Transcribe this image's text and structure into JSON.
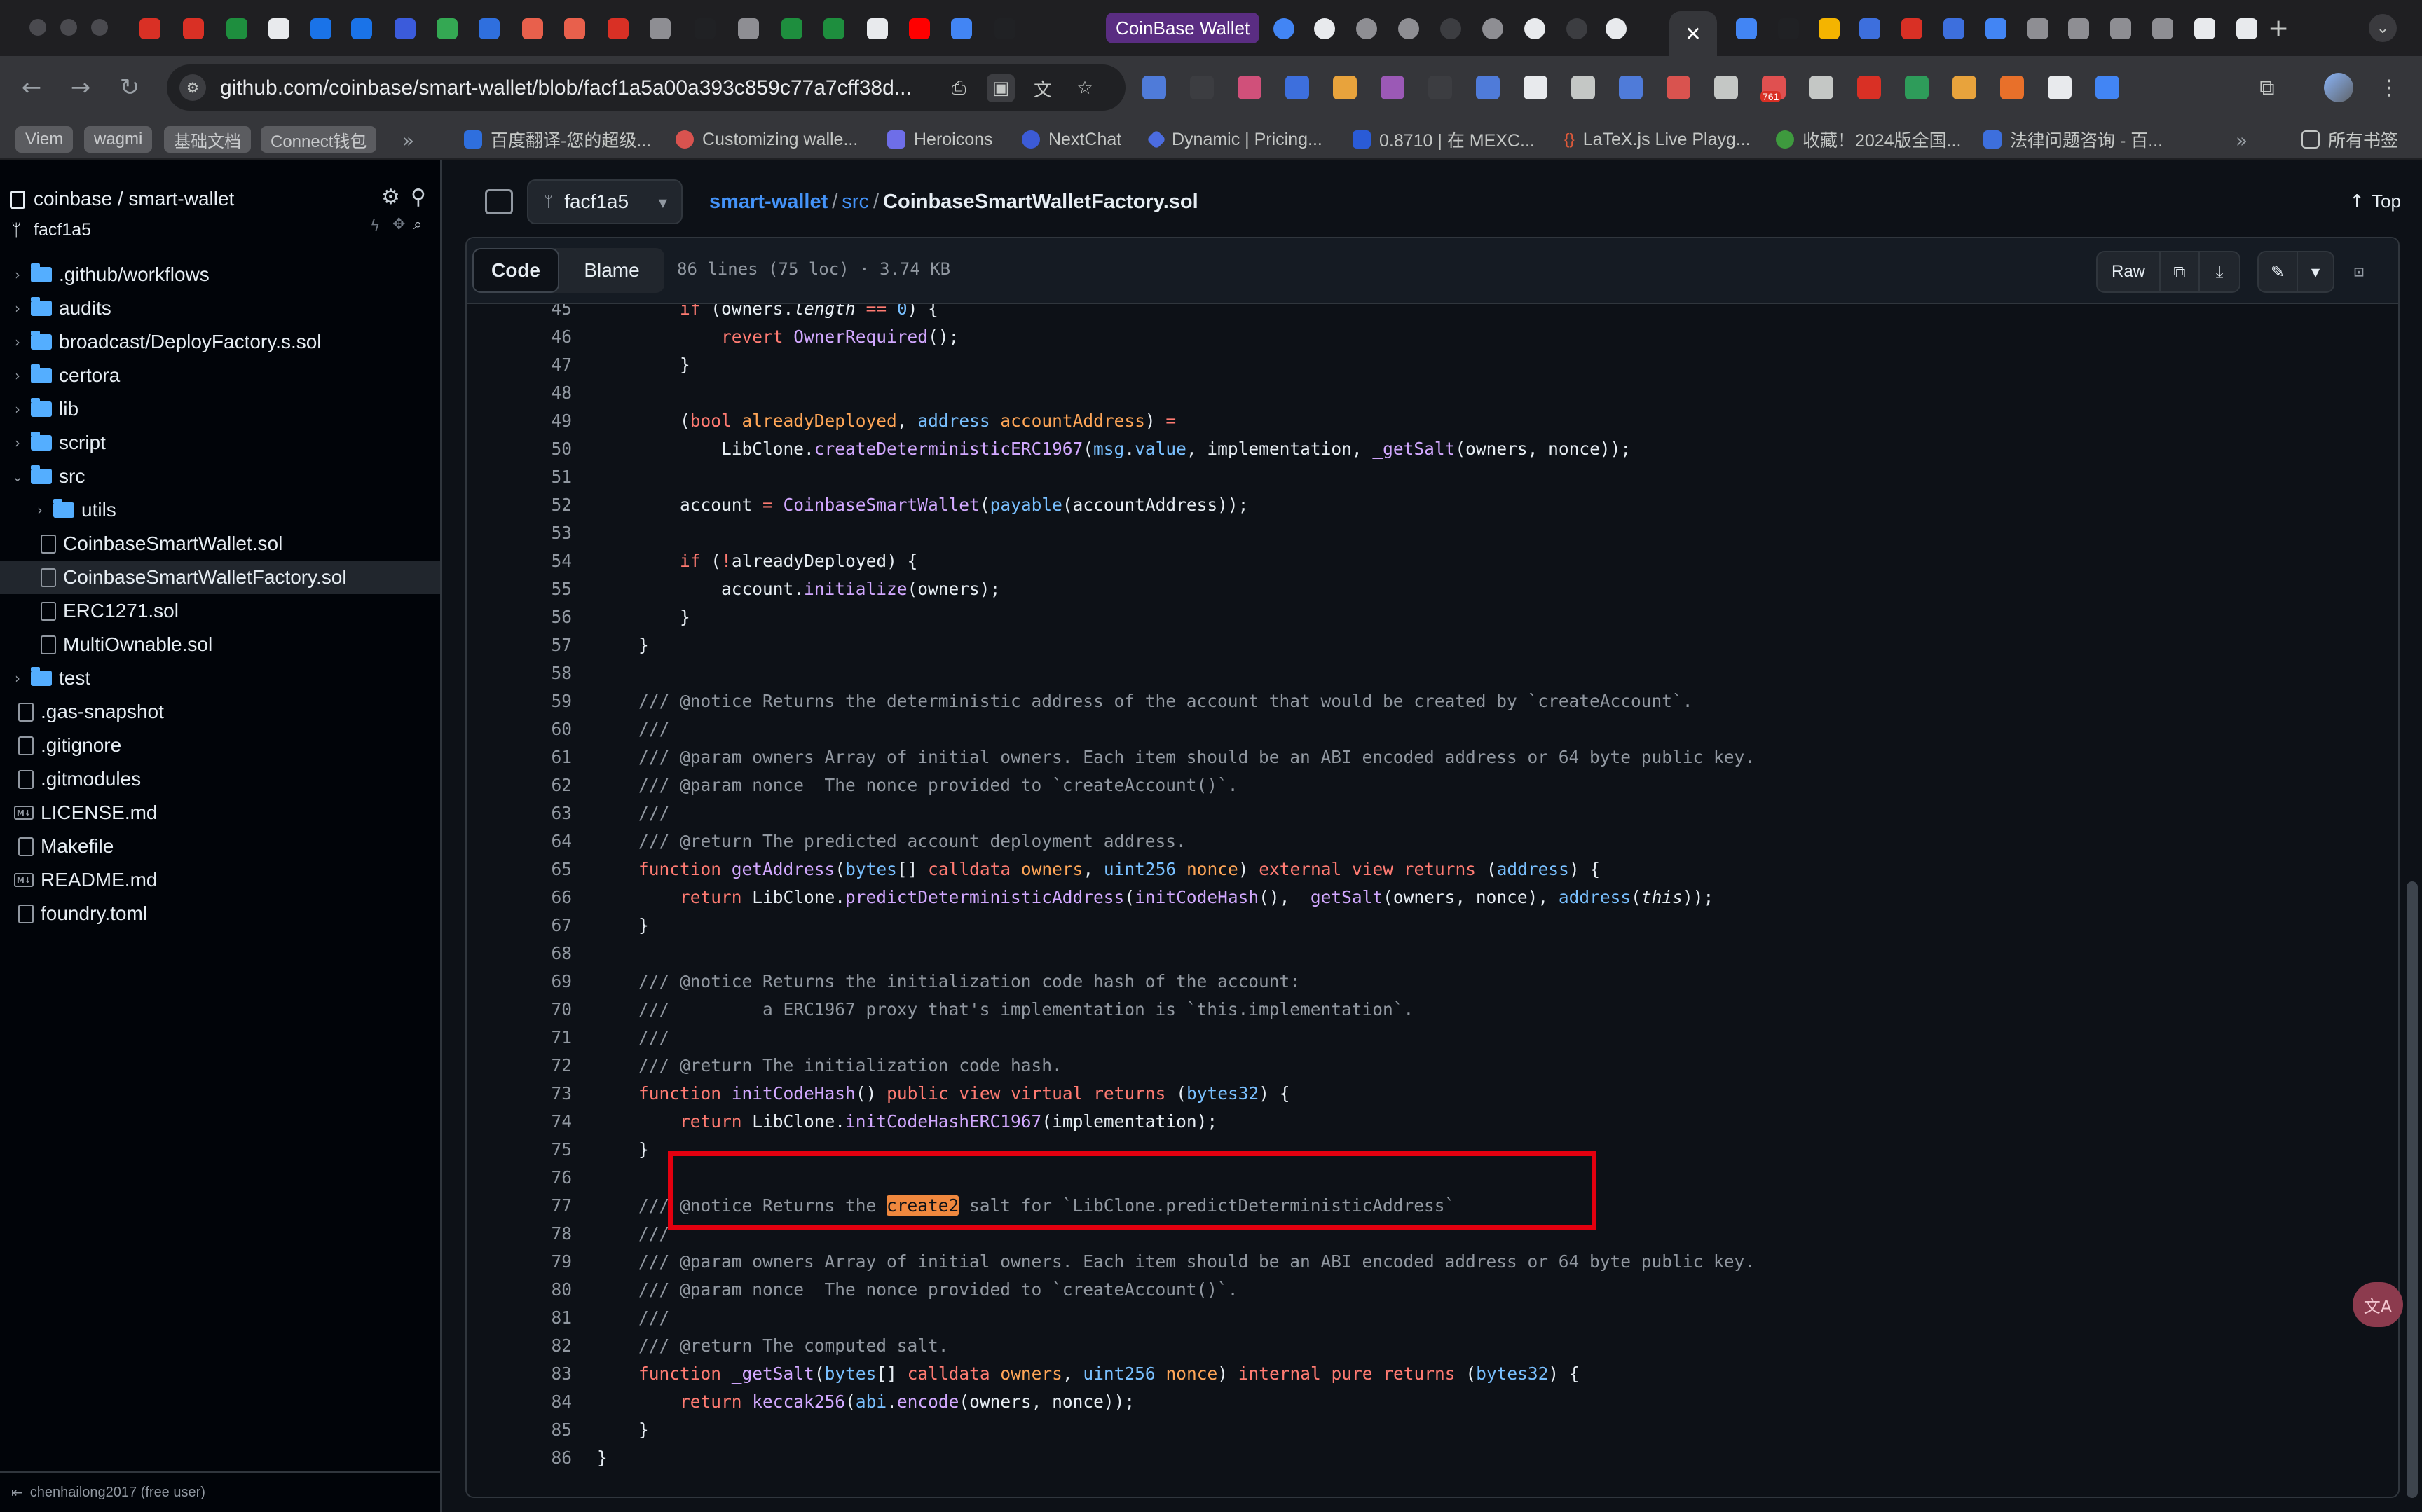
{
  "browser": {
    "labeled_tab": "CoinBase Wallet",
    "url": "github.com/coinbase/smart-wallet/blob/facf1a5a00a393c859c77a7cff38d...",
    "extension_badge": "761",
    "bookmarks": {
      "chips": [
        "Viem",
        "wagmi",
        "基础文档",
        "Connect钱包"
      ],
      "items": [
        "百度翻译-您的超级...",
        "Customizing walle...",
        "Heroicons",
        "NextChat",
        "Dynamic | Pricing...",
        "0.8710 | 在 MEXC...",
        "LaTeX.js Live Playg...",
        "收藏！2024版全国...",
        "法律问题咨询 - 百..."
      ],
      "all_bookmarks": "所有书签"
    }
  },
  "sidebar": {
    "repo": "coinbase / smart-wallet",
    "branch": "facf1a5",
    "tree": [
      {
        "label": ".github/workflows",
        "kind": "folder",
        "caret": "›",
        "depth": 0
      },
      {
        "label": "audits",
        "kind": "folder",
        "caret": "›",
        "depth": 0
      },
      {
        "label": "broadcast/DeployFactory.s.sol",
        "kind": "folder",
        "caret": "›",
        "depth": 0
      },
      {
        "label": "certora",
        "kind": "folder",
        "caret": "›",
        "depth": 0
      },
      {
        "label": "lib",
        "kind": "folder",
        "caret": "›",
        "depth": 0
      },
      {
        "label": "script",
        "kind": "folder",
        "caret": "›",
        "depth": 0
      },
      {
        "label": "src",
        "kind": "folder",
        "caret": "⌄",
        "depth": 0
      },
      {
        "label": "utils",
        "kind": "folder",
        "caret": "›",
        "depth": 1
      },
      {
        "label": "CoinbaseSmartWallet.sol",
        "kind": "file",
        "depth": 1
      },
      {
        "label": "CoinbaseSmartWalletFactory.sol",
        "kind": "file",
        "depth": 1,
        "selected": true
      },
      {
        "label": "ERC1271.sol",
        "kind": "file",
        "depth": 1
      },
      {
        "label": "MultiOwnable.sol",
        "kind": "file",
        "depth": 1
      },
      {
        "label": "test",
        "kind": "folder",
        "caret": "›",
        "depth": 0
      },
      {
        "label": ".gas-snapshot",
        "kind": "file",
        "depth": 0
      },
      {
        "label": ".gitignore",
        "kind": "file",
        "depth": 0
      },
      {
        "label": ".gitmodules",
        "kind": "file",
        "depth": 0
      },
      {
        "label": "LICENSE.md",
        "kind": "md",
        "depth": 0
      },
      {
        "label": "Makefile",
        "kind": "file",
        "depth": 0
      },
      {
        "label": "README.md",
        "kind": "md",
        "depth": 0
      },
      {
        "label": "foundry.toml",
        "kind": "file",
        "depth": 0
      }
    ],
    "footer": "chenhailong2017 (free user)"
  },
  "file_header": {
    "branch": "facf1a5",
    "crumbs": {
      "repo": "smart-wallet",
      "dir": "src",
      "file": "CoinbaseSmartWalletFactory.sol"
    },
    "top_label": "Top"
  },
  "code_view": {
    "tabs": {
      "code": "Code",
      "blame": "Blame"
    },
    "meta": "86 lines (75 loc) · 3.74 KB",
    "raw_label": "Raw"
  },
  "code_lines": [
    {
      "n": "45",
      "t": [
        [
          "        ",
          ""
        ],
        [
          "if",
          "kw"
        ],
        [
          " (owners.",
          ""
        ],
        [
          "length",
          "it"
        ],
        [
          " == ",
          "kw"
        ],
        [
          "0",
          "ty"
        ],
        [
          ") {",
          ""
        ]
      ]
    },
    {
      "n": "46",
      "t": [
        [
          "            ",
          ""
        ],
        [
          "revert",
          "kw"
        ],
        [
          " ",
          ""
        ],
        [
          "OwnerRequired",
          "fn"
        ],
        [
          "();",
          ""
        ]
      ]
    },
    {
      "n": "47",
      "t": [
        [
          "        }",
          ""
        ]
      ]
    },
    {
      "n": "48",
      "t": []
    },
    {
      "n": "49",
      "t": [
        [
          "        (",
          ""
        ],
        [
          "bool",
          "kw"
        ],
        [
          " ",
          ""
        ],
        [
          "alreadyDeployed",
          "vr"
        ],
        [
          ", ",
          ""
        ],
        [
          "address",
          "ty"
        ],
        [
          " ",
          ""
        ],
        [
          "accountAddress",
          "vr"
        ],
        [
          ") ",
          ""
        ],
        [
          "=",
          "kw"
        ]
      ]
    },
    {
      "n": "50",
      "t": [
        [
          "            LibClone.",
          ""
        ],
        [
          "createDeterministicERC1967",
          "fn"
        ],
        [
          "(",
          ""
        ],
        [
          "msg",
          "ty"
        ],
        [
          ".",
          ""
        ],
        [
          "value",
          "ty"
        ],
        [
          ", implementation, ",
          ""
        ],
        [
          "_getSalt",
          "fn"
        ],
        [
          "(owners, nonce));",
          ""
        ]
      ]
    },
    {
      "n": "51",
      "t": []
    },
    {
      "n": "52",
      "t": [
        [
          "        account ",
          ""
        ],
        [
          "=",
          "kw"
        ],
        [
          " ",
          ""
        ],
        [
          "CoinbaseSmartWallet",
          "fn"
        ],
        [
          "(",
          ""
        ],
        [
          "payable",
          "ty"
        ],
        [
          "(accountAddress));",
          ""
        ]
      ]
    },
    {
      "n": "53",
      "t": []
    },
    {
      "n": "54",
      "t": [
        [
          "        ",
          ""
        ],
        [
          "if",
          "kw"
        ],
        [
          " (",
          ""
        ],
        [
          "!",
          "kw"
        ],
        [
          "alreadyDeployed) {",
          ""
        ]
      ]
    },
    {
      "n": "55",
      "t": [
        [
          "            account.",
          ""
        ],
        [
          "initialize",
          "fn"
        ],
        [
          "(owners);",
          ""
        ]
      ]
    },
    {
      "n": "56",
      "t": [
        [
          "        }",
          ""
        ]
      ]
    },
    {
      "n": "57",
      "t": [
        [
          "    }",
          ""
        ]
      ]
    },
    {
      "n": "58",
      "t": []
    },
    {
      "n": "59",
      "t": [
        [
          "    /// @notice Returns the deterministic address of the account that would be created by `createAccount`.",
          "cm"
        ]
      ]
    },
    {
      "n": "60",
      "t": [
        [
          "    ///",
          "cm"
        ]
      ]
    },
    {
      "n": "61",
      "t": [
        [
          "    /// @param owners Array of initial owners. Each item should be an ABI encoded address or 64 byte public key.",
          "cm"
        ]
      ]
    },
    {
      "n": "62",
      "t": [
        [
          "    /// @param nonce  The nonce provided to `createAccount()`.",
          "cm"
        ]
      ]
    },
    {
      "n": "63",
      "t": [
        [
          "    ///",
          "cm"
        ]
      ]
    },
    {
      "n": "64",
      "t": [
        [
          "    /// @return The predicted account deployment address.",
          "cm"
        ]
      ]
    },
    {
      "n": "65",
      "t": [
        [
          "    ",
          ""
        ],
        [
          "function",
          "kw"
        ],
        [
          " ",
          ""
        ],
        [
          "getAddress",
          "fn"
        ],
        [
          "(",
          ""
        ],
        [
          "bytes",
          "ty"
        ],
        [
          "[] ",
          ""
        ],
        [
          "calldata",
          "kw"
        ],
        [
          " ",
          ""
        ],
        [
          "owners",
          "vr"
        ],
        [
          ", ",
          ""
        ],
        [
          "uint256",
          "ty"
        ],
        [
          " ",
          ""
        ],
        [
          "nonce",
          "vr"
        ],
        [
          ") ",
          ""
        ],
        [
          "external",
          "kw"
        ],
        [
          " ",
          ""
        ],
        [
          "view",
          "kw"
        ],
        [
          " ",
          ""
        ],
        [
          "returns",
          "kw"
        ],
        [
          " (",
          ""
        ],
        [
          "address",
          "ty"
        ],
        [
          ") {",
          ""
        ]
      ]
    },
    {
      "n": "66",
      "t": [
        [
          "        ",
          ""
        ],
        [
          "return",
          "kw"
        ],
        [
          " LibClone.",
          ""
        ],
        [
          "predictDeterministicAddress",
          "fn"
        ],
        [
          "(",
          ""
        ],
        [
          "initCodeHash",
          "fn"
        ],
        [
          "(), ",
          ""
        ],
        [
          "_getSalt",
          "fn"
        ],
        [
          "(owners, nonce), ",
          ""
        ],
        [
          "address",
          "ty"
        ],
        [
          "(",
          ""
        ],
        [
          "this",
          "it"
        ],
        [
          "));",
          ""
        ]
      ]
    },
    {
      "n": "67",
      "t": [
        [
          "    }",
          ""
        ]
      ]
    },
    {
      "n": "68",
      "t": []
    },
    {
      "n": "69",
      "t": [
        [
          "    /// @notice Returns the initialization code hash of the account:",
          "cm"
        ]
      ]
    },
    {
      "n": "70",
      "t": [
        [
          "    ///         a ERC1967 proxy that's implementation is `this.implementation`.",
          "cm"
        ]
      ]
    },
    {
      "n": "71",
      "t": [
        [
          "    ///",
          "cm"
        ]
      ]
    },
    {
      "n": "72",
      "t": [
        [
          "    /// @return The initialization code hash.",
          "cm"
        ]
      ]
    },
    {
      "n": "73",
      "t": [
        [
          "    ",
          ""
        ],
        [
          "function",
          "kw"
        ],
        [
          " ",
          ""
        ],
        [
          "initCodeHash",
          "fn"
        ],
        [
          "() ",
          ""
        ],
        [
          "public",
          "kw"
        ],
        [
          " ",
          ""
        ],
        [
          "view",
          "kw"
        ],
        [
          " ",
          ""
        ],
        [
          "virtual",
          "kw"
        ],
        [
          " ",
          ""
        ],
        [
          "returns",
          "kw"
        ],
        [
          " (",
          ""
        ],
        [
          "bytes32",
          "ty"
        ],
        [
          ") {",
          ""
        ]
      ]
    },
    {
      "n": "74",
      "t": [
        [
          "        ",
          ""
        ],
        [
          "return",
          "kw"
        ],
        [
          " LibClone.",
          ""
        ],
        [
          "initCodeHashERC1967",
          "fn"
        ],
        [
          "(implementation);",
          ""
        ]
      ]
    },
    {
      "n": "75",
      "t": [
        [
          "    }",
          ""
        ]
      ]
    },
    {
      "n": "76",
      "t": []
    },
    {
      "n": "77",
      "t": [
        [
          "    /// @notice Returns the ",
          "cm"
        ],
        [
          "create2",
          "hl"
        ],
        [
          " salt for `LibClone.predictDeterministicAddress`",
          "cm"
        ]
      ]
    },
    {
      "n": "78",
      "t": [
        [
          "    ///",
          "cm"
        ]
      ]
    },
    {
      "n": "79",
      "t": [
        [
          "    /// @param owners Array of initial owners. Each item should be an ABI encoded address or 64 byte public key.",
          "cm"
        ]
      ]
    },
    {
      "n": "80",
      "t": [
        [
          "    /// @param nonce  The nonce provided to `createAccount()`.",
          "cm"
        ]
      ]
    },
    {
      "n": "81",
      "t": [
        [
          "    ///",
          "cm"
        ]
      ]
    },
    {
      "n": "82",
      "t": [
        [
          "    /// @return The computed salt.",
          "cm"
        ]
      ]
    },
    {
      "n": "83",
      "t": [
        [
          "    ",
          ""
        ],
        [
          "function",
          "kw"
        ],
        [
          " ",
          ""
        ],
        [
          "_getSalt",
          "fn"
        ],
        [
          "(",
          ""
        ],
        [
          "bytes",
          "ty"
        ],
        [
          "[] ",
          ""
        ],
        [
          "calldata",
          "kw"
        ],
        [
          " ",
          ""
        ],
        [
          "owners",
          "vr"
        ],
        [
          ", ",
          ""
        ],
        [
          "uint256",
          "ty"
        ],
        [
          " ",
          ""
        ],
        [
          "nonce",
          "vr"
        ],
        [
          ") ",
          ""
        ],
        [
          "internal",
          "kw"
        ],
        [
          " ",
          ""
        ],
        [
          "pure",
          "kw"
        ],
        [
          " ",
          ""
        ],
        [
          "returns",
          "kw"
        ],
        [
          " (",
          ""
        ],
        [
          "bytes32",
          "ty"
        ],
        [
          ") {",
          ""
        ]
      ]
    },
    {
      "n": "84",
      "t": [
        [
          "        ",
          ""
        ],
        [
          "return",
          "kw"
        ],
        [
          " ",
          ""
        ],
        [
          "keccak256",
          "fn"
        ],
        [
          "(",
          ""
        ],
        [
          "abi",
          "ty"
        ],
        [
          ".",
          ""
        ],
        [
          "encode",
          "fn"
        ],
        [
          "(owners, nonce));",
          ""
        ]
      ]
    },
    {
      "n": "85",
      "t": [
        [
          "    }",
          ""
        ]
      ]
    },
    {
      "n": "86",
      "t": [
        [
          "}",
          ""
        ]
      ]
    }
  ],
  "colors": {
    "keyword": "#ff7b72",
    "type": "#79c0ff",
    "function": "#d2a8ff",
    "variable": "#ffa657",
    "comment": "#9198a1",
    "search_highlight": "#f0883e",
    "annotation_box": "#e3000f"
  },
  "icons": [
    "github-icon",
    "gear-icon",
    "pin-icon",
    "branch-icon",
    "copy-icon",
    "download-icon",
    "pencil-icon",
    "symbols-icon",
    "arrow-up-icon",
    "translate-icon"
  ]
}
